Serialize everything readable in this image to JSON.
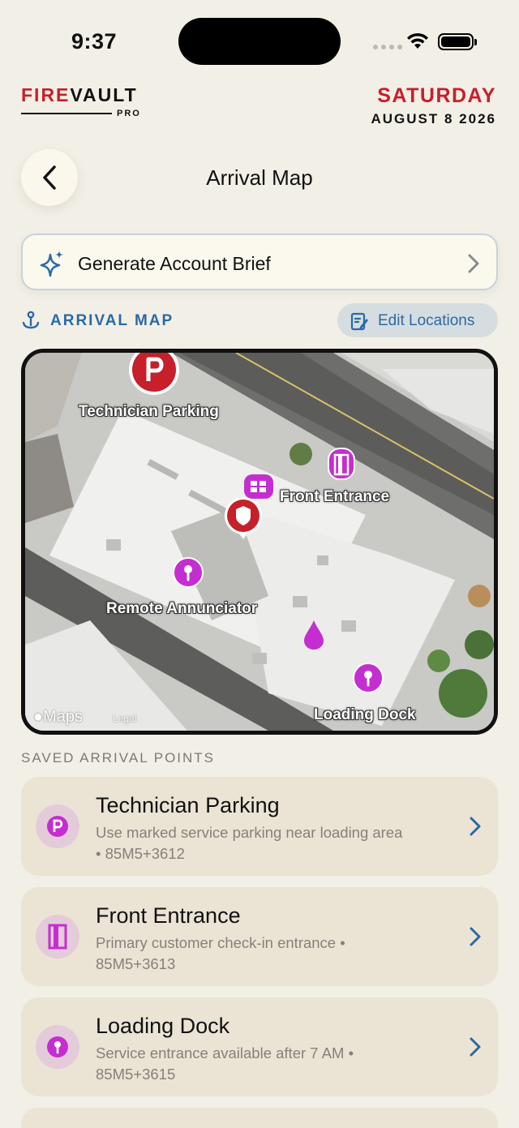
{
  "status": {
    "time": "9:37"
  },
  "brand": {
    "fire": "FIRE",
    "vault": "VAULT",
    "pro": "PRO"
  },
  "header_date": {
    "weekday": "SATURDAY",
    "date": "AUGUST 8 2026"
  },
  "nav": {
    "title": "Arrival Map"
  },
  "brief_button": {
    "label": "Generate Account Brief"
  },
  "map_section": {
    "label": "ARRIVAL MAP",
    "edit_label": "Edit Locations"
  },
  "map": {
    "pins": [
      {
        "label": "Technician Parking",
        "icon": "parking-icon"
      },
      {
        "label": "Front Entrance",
        "icon": "door-icon"
      },
      {
        "label": "Remote Annunciator",
        "icon": "pin-icon"
      },
      {
        "label": "Loading Dock",
        "icon": "pin-icon"
      }
    ],
    "attribution": "Maps",
    "legal": "Legal"
  },
  "saved": {
    "title": "SAVED ARRIVAL POINTS",
    "items": [
      {
        "title": "Technician Parking",
        "sub": "Use marked service parking near loading area • 85M5+3612",
        "icon": "parking-icon"
      },
      {
        "title": "Front Entrance",
        "sub": "Primary customer check-in entrance • 85M5+3613",
        "icon": "door-icon"
      },
      {
        "title": "Loading Dock",
        "sub": "Service entrance available after 7 AM • 85M5+3615",
        "icon": "pin-icon"
      }
    ]
  },
  "colors": {
    "brand_red": "#c6202a",
    "accent_blue": "#2a6aa5",
    "pin_magenta": "#c42ed0"
  }
}
